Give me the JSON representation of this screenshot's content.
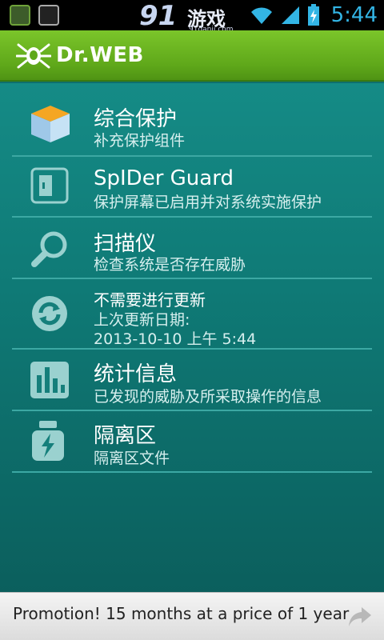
{
  "status_bar": {
    "time": "5:44",
    "watermark_number": "91",
    "watermark_text": "游戏",
    "watermark_url": "91danji.com"
  },
  "header": {
    "title": "Dr.WEB"
  },
  "menu": {
    "items": [
      {
        "title": "综合保护",
        "subtitle": "补充保护组件"
      },
      {
        "title": "SpIDer Guard",
        "subtitle": "保护屏幕已启用并对系统实施保护"
      },
      {
        "title": "扫描仪",
        "subtitle": "检查系统是否存在威胁"
      },
      {
        "title": "不需要进行更新",
        "subtitle": "上次更新日期:",
        "subtitle2": "2013-10-10 上午 5:44"
      },
      {
        "title": "统计信息",
        "subtitle": "已发现的威胁及所采取操作的信息"
      },
      {
        "title": "隔离区",
        "subtitle": "隔离区文件"
      }
    ]
  },
  "promo": {
    "text": "Promotion! 15 months at a price of 1 year"
  },
  "colors": {
    "accent_green": "#6cbf25",
    "teal": "#0f7a76",
    "status_blue": "#33b5e5"
  }
}
